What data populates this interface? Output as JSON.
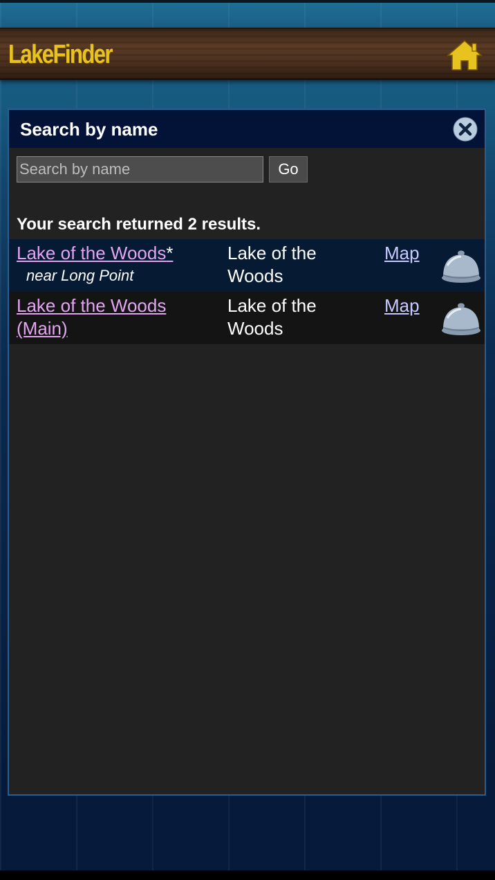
{
  "app": {
    "logo_text": "LakeFinder",
    "home_icon": "home-icon"
  },
  "dialog": {
    "title": "Search by name",
    "close_icon": "close-icon"
  },
  "search": {
    "placeholder": "Search by name",
    "value": "",
    "go_label": "Go"
  },
  "results": {
    "summary": "Your search returned 2 results.",
    "rows": [
      {
        "name": "Lake of the Woods",
        "suffix": "*",
        "note": "near Long Point",
        "county": "Lake of the Woods",
        "map_label": "Map",
        "icon": "bell-icon"
      },
      {
        "name": "Lake of the Woods (Main)",
        "suffix": "",
        "note": "",
        "county": "Lake of the Woods",
        "map_label": "Map",
        "icon": "bell-icon"
      }
    ]
  },
  "colors": {
    "logo": "#e8c21e",
    "link": "#e2a6f0",
    "map_link": "#c7c9ff",
    "dialog_header": "#031237"
  }
}
